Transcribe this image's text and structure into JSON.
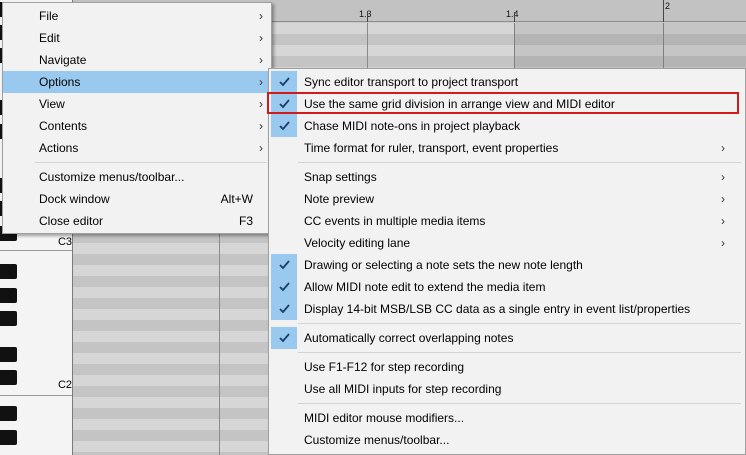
{
  "piano": {
    "octave_labels": [
      "C3",
      "C2"
    ]
  },
  "ruler": {
    "marks": [
      "1.3",
      "1.4",
      "2"
    ]
  },
  "main_menu": {
    "items": [
      {
        "label": "File",
        "submenu": true
      },
      {
        "label": "Edit",
        "submenu": true
      },
      {
        "label": "Navigate",
        "submenu": true
      },
      {
        "label": "Options",
        "submenu": true,
        "active": true
      },
      {
        "label": "View",
        "submenu": true
      },
      {
        "label": "Contents",
        "submenu": true
      },
      {
        "label": "Actions",
        "submenu": true
      },
      {
        "label": "Customize menus/toolbar..."
      },
      {
        "label": "Dock window",
        "shortcut": "Alt+W"
      },
      {
        "label": "Close editor",
        "shortcut": "F3"
      }
    ]
  },
  "options_menu": {
    "items": [
      {
        "label": "Sync editor transport to project transport",
        "checked": true
      },
      {
        "label": "Use the same grid division in arrange view and MIDI editor",
        "checked": true,
        "highlighted": true
      },
      {
        "label": "Chase MIDI note-ons in project playback",
        "checked": true
      },
      {
        "label": "Time format for ruler, transport, event properties",
        "submenu": true
      },
      {
        "label": "Snap settings",
        "submenu": true
      },
      {
        "label": "Note preview",
        "submenu": true
      },
      {
        "label": "CC events in multiple media items",
        "submenu": true
      },
      {
        "label": "Velocity editing lane",
        "submenu": true
      },
      {
        "label": "Drawing or selecting a note sets the new note length",
        "checked": true
      },
      {
        "label": "Allow MIDI note edit to extend the media item",
        "checked": true
      },
      {
        "label": "Display 14-bit MSB/LSB CC data as a single entry in event list/properties",
        "checked": true
      },
      {
        "label": "Automatically correct overlapping notes",
        "checked": true
      },
      {
        "label": "Use F1-F12 for step recording"
      },
      {
        "label": "Use all MIDI inputs for step recording"
      },
      {
        "label": "MIDI editor mouse modifiers..."
      },
      {
        "label": "Customize menus/toolbar..."
      }
    ]
  },
  "icons": {
    "submenu_arrow": "›",
    "check": "checkmark-icon"
  },
  "colors": {
    "menu_hover": "#99c9ef",
    "highlight_box": "#d11a1a",
    "menu_bg": "#f2f2f2"
  }
}
